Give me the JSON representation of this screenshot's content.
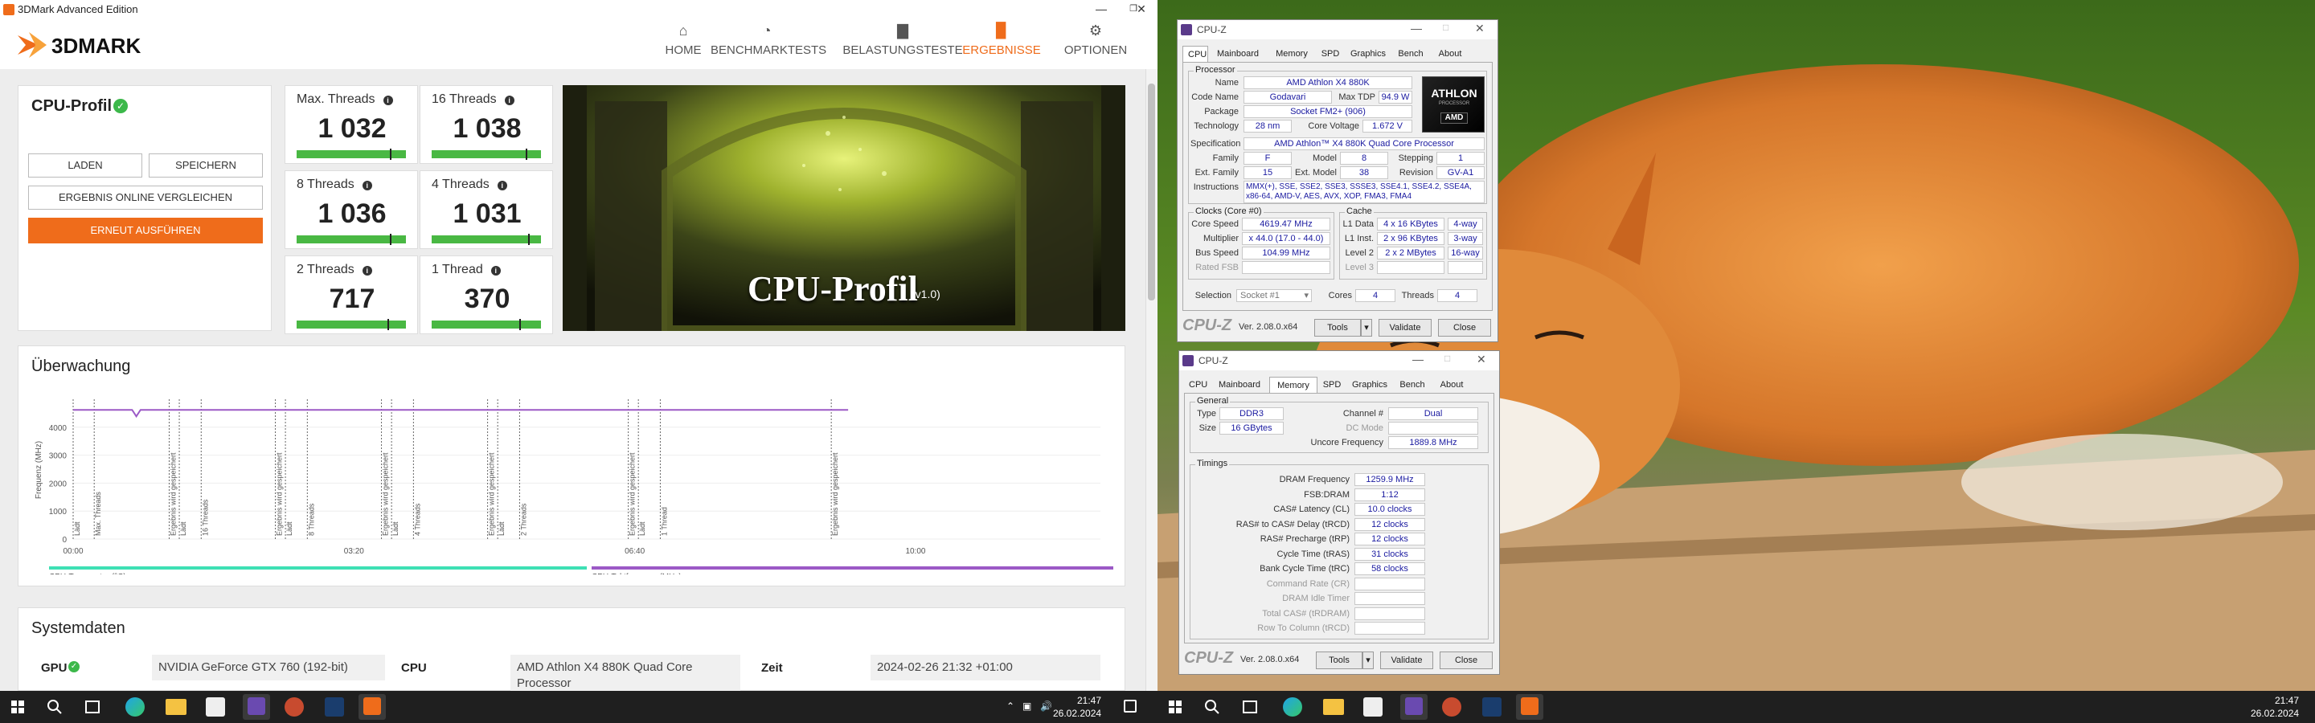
{
  "tdm": {
    "window_title": "3DMark Advanced Edition",
    "logo_text": "3DMARK",
    "nav": [
      {
        "label": "HOME",
        "icon": "home-icon",
        "glyph": "⌂"
      },
      {
        "label": "BENCHMARKTESTS",
        "icon": "speedometer-icon",
        "glyph": "◔"
      },
      {
        "label": "BELASTUNGSTESTE",
        "icon": "bar-chart-icon",
        "glyph": "▇"
      },
      {
        "label": "ERGEBNISSE",
        "icon": "results-chart-icon",
        "glyph": "▉"
      },
      {
        "label": "OPTIONEN",
        "icon": "gear-icon",
        "glyph": "⚙"
      }
    ],
    "active_nav": "ERGEBNISSE",
    "profile": {
      "title": "CPU-Profil",
      "btn_load": "LADEN",
      "btn_save": "SPEICHERN",
      "btn_compare": "ERGEBNIS ONLINE VERGLEICHEN",
      "btn_run": "ERNEUT AUSFÜHREN"
    },
    "scores": [
      {
        "label": "Max. Threads",
        "value": "1 032",
        "fill": 0.85
      },
      {
        "label": "16 Threads",
        "value": "1 038",
        "fill": 0.86
      },
      {
        "label": "8 Threads",
        "value": "1 036",
        "fill": 0.85
      },
      {
        "label": "4 Threads",
        "value": "1 031",
        "fill": 0.88
      },
      {
        "label": "2 Threads",
        "value": "717",
        "fill": 0.83
      },
      {
        "label": "1 Thread",
        "value": "370",
        "fill": 0.8
      }
    ],
    "banner": {
      "title": "CPU-Profil",
      "version": "(v1.0)"
    },
    "monitor": {
      "title": "Überwachung",
      "ylabel": "Frequenz (MHz)"
    },
    "system": {
      "title": "Systemdaten",
      "gpu_label": "GPU",
      "gpu_value": "NVIDIA GeForce GTX 760 (192-bit)",
      "cpu_label": "CPU",
      "cpu_value": "AMD Athlon X4 880K Quad Core Processor",
      "time_label": "Zeit",
      "time_value": "2024-02-26 21:32 +01:00"
    }
  },
  "chart_data": {
    "type": "line",
    "ylabel": "Frequenz (MHz)",
    "ylim": [
      0,
      5000
    ],
    "yticks": [
      "4000",
      "3000",
      "2000",
      "1000",
      "0"
    ],
    "xticks": [
      "00:00",
      "03:20",
      "06:40",
      "10:00"
    ],
    "series": [
      {
        "name": "CPU-Temperatur (°C)",
        "color": "#3ee0b4"
      },
      {
        "name": "CPU-Taktfrequenz (MHz)",
        "color": "#9b59c6",
        "values_approx": 4619
      }
    ],
    "markers": [
      {
        "x": 0.0,
        "label": "Lädt"
      },
      {
        "x": 0.025,
        "label": "Max. Threads"
      },
      {
        "x": 0.114,
        "label": "Ergebnis wird gespeichert"
      },
      {
        "x": 0.126,
        "label": "Lädt"
      },
      {
        "x": 0.152,
        "label": "16 Threads"
      },
      {
        "x": 0.24,
        "label": "Ergebnis wird gespeichert"
      },
      {
        "x": 0.252,
        "label": "Lädt"
      },
      {
        "x": 0.278,
        "label": "8 Threads"
      },
      {
        "x": 0.366,
        "label": "Ergebnis wird gespeichert"
      },
      {
        "x": 0.378,
        "label": "Lädt"
      },
      {
        "x": 0.404,
        "label": "4 Threads"
      },
      {
        "x": 0.492,
        "label": "Ergebnis wird gespeichert"
      },
      {
        "x": 0.504,
        "label": "Lädt"
      },
      {
        "x": 0.53,
        "label": "2 Threads"
      },
      {
        "x": 0.659,
        "label": "Ergebnis wird gespeichert"
      },
      {
        "x": 0.671,
        "label": "Lädt"
      },
      {
        "x": 0.697,
        "label": "1 Thread"
      },
      {
        "x": 0.9,
        "label": "Ergebnis wird gespeichert"
      }
    ]
  },
  "cpuz1": {
    "title": "CPU-Z",
    "tabs": [
      "CPU",
      "Mainboard",
      "Memory",
      "SPD",
      "Graphics",
      "Bench",
      "About"
    ],
    "selected_tab": "CPU",
    "processor_group": "Processor",
    "name_l": "Name",
    "name": "AMD Athlon X4 880K",
    "code_l": "Code Name",
    "code": "Godavari",
    "tdp_l": "Max TDP",
    "tdp": "94.9 W",
    "pkg_l": "Package",
    "pkg": "Socket FM2+ (906)",
    "tech_l": "Technology",
    "tech": "28 nm",
    "volt_l": "Core Voltage",
    "volt": "1.672 V",
    "spec_l": "Specification",
    "spec": "AMD Athlon™ X4 880K Quad Core Processor",
    "fam_l": "Family",
    "fam": "F",
    "model_l": "Model",
    "model": "8",
    "step_l": "Stepping",
    "step": "1",
    "efam_l": "Ext. Family",
    "efam": "15",
    "emodel_l": "Ext. Model",
    "emodel": "38",
    "rev_l": "Revision",
    "rev": "GV-A1",
    "instr_l": "Instructions",
    "instr1": "MMX(+), SSE, SSE2, SSE3, SSSE3, SSE4.1, SSE4.2, SSE4A,",
    "instr2": "x86-64, AMD-V, AES, AVX, XOP, FMA3, FMA4",
    "badge_top": "ATHLON",
    "badge_mid": "PROCESSOR",
    "badge_bot": "AMD",
    "clocks_group": "Clocks (Core #0)",
    "cspeed_l": "Core Speed",
    "cspeed": "4619.47 MHz",
    "mult_l": "Multiplier",
    "mult": "x 44.0 (17.0 - 44.0)",
    "bus_l": "Bus Speed",
    "bus": "104.99 MHz",
    "fsb_l": "Rated FSB",
    "fsb": "",
    "cache_group": "Cache",
    "l1d_l": "L1 Data",
    "l1d": "4 x 16 KBytes",
    "l1d_w": "4-way",
    "l1i_l": "L1 Inst.",
    "l1i": "2 x 96 KBytes",
    "l1i_w": "3-way",
    "l2_l": "Level 2",
    "l2": "2 x 2 MBytes",
    "l2_w": "16-way",
    "l3_l": "Level 3",
    "l3": "",
    "sel_l": "Selection",
    "sel": "Socket #1",
    "cores_l": "Cores",
    "cores": "4",
    "threads_l": "Threads",
    "threads": "4",
    "brand": "CPU-Z",
    "version": "Ver. 2.08.0.x64",
    "tools": "Tools",
    "validate": "Validate",
    "close": "Close"
  },
  "cpuz2": {
    "title": "CPU-Z",
    "tabs": [
      "CPU",
      "Mainboard",
      "Memory",
      "SPD",
      "Graphics",
      "Bench",
      "About"
    ],
    "selected_tab": "Memory",
    "general_group": "General",
    "type_l": "Type",
    "type": "DDR3",
    "size_l": "Size",
    "size": "16 GBytes",
    "chan_l": "Channel #",
    "chan": "Dual",
    "dc_l": "DC Mode",
    "dc": "",
    "unc_l": "Uncore Frequency",
    "unc": "1889.8 MHz",
    "timings_group": "Timings",
    "rows": [
      {
        "l": "DRAM Frequency",
        "v": "1259.9 MHz"
      },
      {
        "l": "FSB:DRAM",
        "v": "1:12"
      },
      {
        "l": "CAS# Latency (CL)",
        "v": "10.0 clocks"
      },
      {
        "l": "RAS# to CAS# Delay (tRCD)",
        "v": "12 clocks"
      },
      {
        "l": "RAS# Precharge (tRP)",
        "v": "12 clocks"
      },
      {
        "l": "Cycle Time (tRAS)",
        "v": "31 clocks"
      },
      {
        "l": "Bank Cycle Time (tRC)",
        "v": "58 clocks"
      },
      {
        "l": "Command Rate (CR)",
        "v": ""
      },
      {
        "l": "DRAM Idle Timer",
        "v": ""
      },
      {
        "l": "Total CAS# (tRDRAM)",
        "v": ""
      },
      {
        "l": "Row To Column (tRCD)",
        "v": ""
      }
    ],
    "brand": "CPU-Z",
    "version": "Ver. 2.08.0.x64",
    "tools": "Tools",
    "validate": "Validate",
    "close": "Close"
  },
  "taskbar_left": {
    "time": "21:47",
    "date": "26.02.2024"
  },
  "taskbar_right": {
    "time": "21:47",
    "date": "26.02.2024"
  }
}
